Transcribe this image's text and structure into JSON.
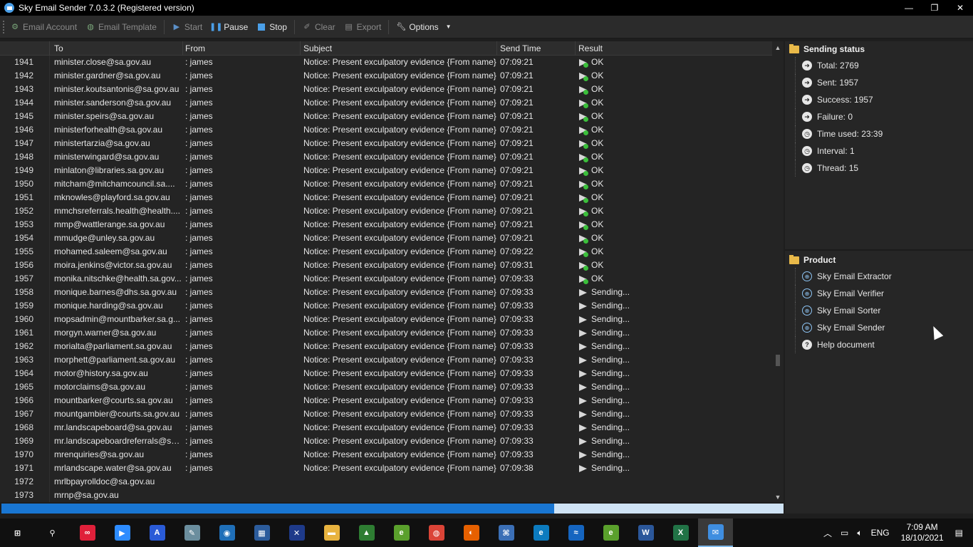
{
  "window": {
    "title": "Sky Email Sender 7.0.3.2 (Registered version)",
    "controls": [
      "—",
      "❐",
      "✕"
    ]
  },
  "toolbar": {
    "email_account": "Email Account",
    "email_template": "Email Template",
    "start": "Start",
    "pause": "Pause",
    "stop": "Stop",
    "clear": "Clear",
    "export": "Export",
    "options": "Options"
  },
  "grid": {
    "columns": {
      "to": "To",
      "from": "From",
      "subject": "Subject",
      "send_time": "Send Time",
      "result": "Result"
    },
    "rows": [
      {
        "n": "1941",
        "to": "minister.close@sa.gov.au",
        "from": ": james",
        "subject": "Notice: Present exculpatory evidence {From name}",
        "time": "07:09:21",
        "result": "OK",
        "status": "ok"
      },
      {
        "n": "1942",
        "to": "minister.gardner@sa.gov.au",
        "from": ": james",
        "subject": "Notice: Present exculpatory evidence {From name}",
        "time": "07:09:21",
        "result": "OK",
        "status": "ok"
      },
      {
        "n": "1943",
        "to": "minister.koutsantonis@sa.gov.au",
        "from": ": james",
        "subject": "Notice: Present exculpatory evidence {From name}",
        "time": "07:09:21",
        "result": "OK",
        "status": "ok"
      },
      {
        "n": "1944",
        "to": "minister.sanderson@sa.gov.au",
        "from": ": james",
        "subject": "Notice: Present exculpatory evidence {From name}",
        "time": "07:09:21",
        "result": "OK",
        "status": "ok"
      },
      {
        "n": "1945",
        "to": "minister.speirs@sa.gov.au",
        "from": ": james",
        "subject": "Notice: Present exculpatory evidence {From name}",
        "time": "07:09:21",
        "result": "OK",
        "status": "ok"
      },
      {
        "n": "1946",
        "to": "ministerforhealth@sa.gov.au",
        "from": ": james",
        "subject": "Notice: Present exculpatory evidence {From name}",
        "time": "07:09:21",
        "result": "OK",
        "status": "ok"
      },
      {
        "n": "1947",
        "to": "ministertarzia@sa.gov.au",
        "from": ": james",
        "subject": "Notice: Present exculpatory evidence {From name}",
        "time": "07:09:21",
        "result": "OK",
        "status": "ok"
      },
      {
        "n": "1948",
        "to": "ministerwingard@sa.gov.au",
        "from": ": james",
        "subject": "Notice: Present exculpatory evidence {From name}",
        "time": "07:09:21",
        "result": "OK",
        "status": "ok"
      },
      {
        "n": "1949",
        "to": "minlaton@libraries.sa.gov.au",
        "from": ": james",
        "subject": "Notice: Present exculpatory evidence {From name}",
        "time": "07:09:21",
        "result": "OK",
        "status": "ok"
      },
      {
        "n": "1950",
        "to": "mitcham@mitchamcouncil.sa....",
        "from": ": james",
        "subject": "Notice: Present exculpatory evidence {From name}",
        "time": "07:09:21",
        "result": "OK",
        "status": "ok"
      },
      {
        "n": "1951",
        "to": "mknowles@playford.sa.gov.au",
        "from": ": james",
        "subject": "Notice: Present exculpatory evidence {From name}",
        "time": "07:09:21",
        "result": "OK",
        "status": "ok"
      },
      {
        "n": "1952",
        "to": "mmchsreferrals.health@health....",
        "from": ": james",
        "subject": "Notice: Present exculpatory evidence {From name}",
        "time": "07:09:21",
        "result": "OK",
        "status": "ok"
      },
      {
        "n": "1953",
        "to": "mmp@wattlerange.sa.gov.au",
        "from": ": james",
        "subject": "Notice: Present exculpatory evidence {From name}",
        "time": "07:09:21",
        "result": "OK",
        "status": "ok"
      },
      {
        "n": "1954",
        "to": "mmudge@unley.sa.gov.au",
        "from": ": james",
        "subject": "Notice: Present exculpatory evidence {From name}",
        "time": "07:09:21",
        "result": "OK",
        "status": "ok"
      },
      {
        "n": "1955",
        "to": "mohamed.saleem@sa.gov.au",
        "from": ": james",
        "subject": "Notice: Present exculpatory evidence {From name}",
        "time": "07:09:22",
        "result": "OK",
        "status": "ok"
      },
      {
        "n": "1956",
        "to": "moira.jenkins@victor.sa.gov.au",
        "from": ": james",
        "subject": "Notice: Present exculpatory evidence {From name}",
        "time": "07:09:31",
        "result": "OK",
        "status": "ok"
      },
      {
        "n": "1957",
        "to": "monika.nitschke@health.sa.gov...",
        "from": ": james",
        "subject": "Notice: Present exculpatory evidence {From name}",
        "time": "07:09:33",
        "result": "OK",
        "status": "ok"
      },
      {
        "n": "1958",
        "to": "monique.barnes@dhs.sa.gov.au",
        "from": ": james",
        "subject": "Notice: Present exculpatory evidence {From name}",
        "time": "07:09:33",
        "result": "Sending...",
        "status": "sending"
      },
      {
        "n": "1959",
        "to": "monique.harding@sa.gov.au",
        "from": ": james",
        "subject": "Notice: Present exculpatory evidence {From name}",
        "time": "07:09:33",
        "result": "Sending...",
        "status": "sending"
      },
      {
        "n": "1960",
        "to": "mopsadmin@mountbarker.sa.g...",
        "from": ": james",
        "subject": "Notice: Present exculpatory evidence {From name}",
        "time": "07:09:33",
        "result": "Sending...",
        "status": "sending"
      },
      {
        "n": "1961",
        "to": "morgyn.warner@sa.gov.au",
        "from": ": james",
        "subject": "Notice: Present exculpatory evidence {From name}",
        "time": "07:09:33",
        "result": "Sending...",
        "status": "sending"
      },
      {
        "n": "1962",
        "to": "morialta@parliament.sa.gov.au",
        "from": ": james",
        "subject": "Notice: Present exculpatory evidence {From name}",
        "time": "07:09:33",
        "result": "Sending...",
        "status": "sending"
      },
      {
        "n": "1963",
        "to": "morphett@parliament.sa.gov.au",
        "from": ": james",
        "subject": "Notice: Present exculpatory evidence {From name}",
        "time": "07:09:33",
        "result": "Sending...",
        "status": "sending"
      },
      {
        "n": "1964",
        "to": "motor@history.sa.gov.au",
        "from": ": james",
        "subject": "Notice: Present exculpatory evidence {From name}",
        "time": "07:09:33",
        "result": "Sending...",
        "status": "sending"
      },
      {
        "n": "1965",
        "to": "motorclaims@sa.gov.au",
        "from": ": james",
        "subject": "Notice: Present exculpatory evidence {From name}",
        "time": "07:09:33",
        "result": "Sending...",
        "status": "sending"
      },
      {
        "n": "1966",
        "to": "mountbarker@courts.sa.gov.au",
        "from": ": james",
        "subject": "Notice: Present exculpatory evidence {From name}",
        "time": "07:09:33",
        "result": "Sending...",
        "status": "sending"
      },
      {
        "n": "1967",
        "to": "mountgambier@courts.sa.gov.au",
        "from": ": james",
        "subject": "Notice: Present exculpatory evidence {From name}",
        "time": "07:09:33",
        "result": "Sending...",
        "status": "sending"
      },
      {
        "n": "1968",
        "to": "mr.landscapeboard@sa.gov.au",
        "from": ": james",
        "subject": "Notice: Present exculpatory evidence {From name}",
        "time": "07:09:33",
        "result": "Sending...",
        "status": "sending"
      },
      {
        "n": "1969",
        "to": "mr.landscapeboardreferrals@sa....",
        "from": ": james",
        "subject": "Notice: Present exculpatory evidence {From name}",
        "time": "07:09:33",
        "result": "Sending...",
        "status": "sending"
      },
      {
        "n": "1970",
        "to": "mrenquiries@sa.gov.au",
        "from": ": james",
        "subject": "Notice: Present exculpatory evidence {From name}",
        "time": "07:09:33",
        "result": "Sending...",
        "status": "sending"
      },
      {
        "n": "1971",
        "to": "mrlandscape.water@sa.gov.au",
        "from": ": james",
        "subject": "Notice: Present exculpatory evidence {From name}",
        "time": "07:09:38",
        "result": "Sending...",
        "status": "sending"
      },
      {
        "n": "1972",
        "to": "mrlbpayrolldoc@sa.gov.au",
        "from": "",
        "subject": "",
        "time": "",
        "result": "",
        "status": "none"
      },
      {
        "n": "1973",
        "to": "mrnp@sa.gov.au",
        "from": "",
        "subject": "",
        "time": "",
        "result": "",
        "status": "none"
      }
    ]
  },
  "progress": {
    "fraction": 0.707
  },
  "sending_status": {
    "title": "Sending status",
    "items": [
      {
        "icon": "arrow-right-icon",
        "label": "Total: 2769"
      },
      {
        "icon": "arrow-right-icon",
        "label": "Sent: 1957"
      },
      {
        "icon": "arrow-right-icon",
        "label": "Success: 1957"
      },
      {
        "icon": "arrow-right-icon",
        "label": "Failure: 0"
      },
      {
        "icon": "clock-icon",
        "label": "Time used: 23:39"
      },
      {
        "icon": "clock-icon",
        "label": "Interval: 1"
      },
      {
        "icon": "clock-icon",
        "label": "Thread: 15"
      }
    ]
  },
  "product": {
    "title": "Product",
    "items": [
      {
        "icon": "globe-icon",
        "label": "Sky Email Extractor"
      },
      {
        "icon": "globe-icon",
        "label": "Sky Email Verifier"
      },
      {
        "icon": "globe-icon",
        "label": "Sky Email Sorter"
      },
      {
        "icon": "globe-icon",
        "label": "Sky Email Sender"
      },
      {
        "icon": "help-icon",
        "label": "Help document"
      }
    ]
  },
  "taskbar": {
    "apps": [
      {
        "name": "start-button",
        "color": "#101010",
        "glyph": "⊞"
      },
      {
        "name": "search",
        "color": "#101010",
        "glyph": "⚲"
      },
      {
        "name": "app-red",
        "color": "#e0203a",
        "glyph": "∞"
      },
      {
        "name": "zoom",
        "color": "#2d8cff",
        "glyph": "▶"
      },
      {
        "name": "app-blue-a",
        "color": "#2a5bd7",
        "glyph": "A"
      },
      {
        "name": "app-paint",
        "color": "#6b8e9e",
        "glyph": "✎"
      },
      {
        "name": "app-circle",
        "color": "#1f6fb8",
        "glyph": "◉"
      },
      {
        "name": "calculator",
        "color": "#2c5c9c",
        "glyph": "▦"
      },
      {
        "name": "app-x",
        "color": "#1e3a8a",
        "glyph": "✕"
      },
      {
        "name": "file-explorer",
        "color": "#e8b33f",
        "glyph": "▬"
      },
      {
        "name": "app-chart",
        "color": "#2e7d32",
        "glyph": "▲"
      },
      {
        "name": "app-green-e",
        "color": "#5aa02c",
        "glyph": "e"
      },
      {
        "name": "chrome",
        "color": "#db4437",
        "glyph": "◍"
      },
      {
        "name": "firefox",
        "color": "#e66000",
        "glyph": "◐"
      },
      {
        "name": "app-network",
        "color": "#3b6fb6",
        "glyph": "⌘"
      },
      {
        "name": "edge",
        "color": "#0c7bbf",
        "glyph": "e"
      },
      {
        "name": "app-blue-wave",
        "color": "#1565c0",
        "glyph": "≈"
      },
      {
        "name": "app-green-e2",
        "color": "#5aa02c",
        "glyph": "e"
      },
      {
        "name": "word",
        "color": "#2b579a",
        "glyph": "W"
      },
      {
        "name": "excel",
        "color": "#217346",
        "glyph": "X"
      },
      {
        "name": "sky-email-sender",
        "color": "#3f8ee0",
        "glyph": "✉",
        "active": true
      }
    ],
    "tray": {
      "lang": "ENG",
      "time": "7:09 AM",
      "date": "18/10/2021"
    }
  }
}
